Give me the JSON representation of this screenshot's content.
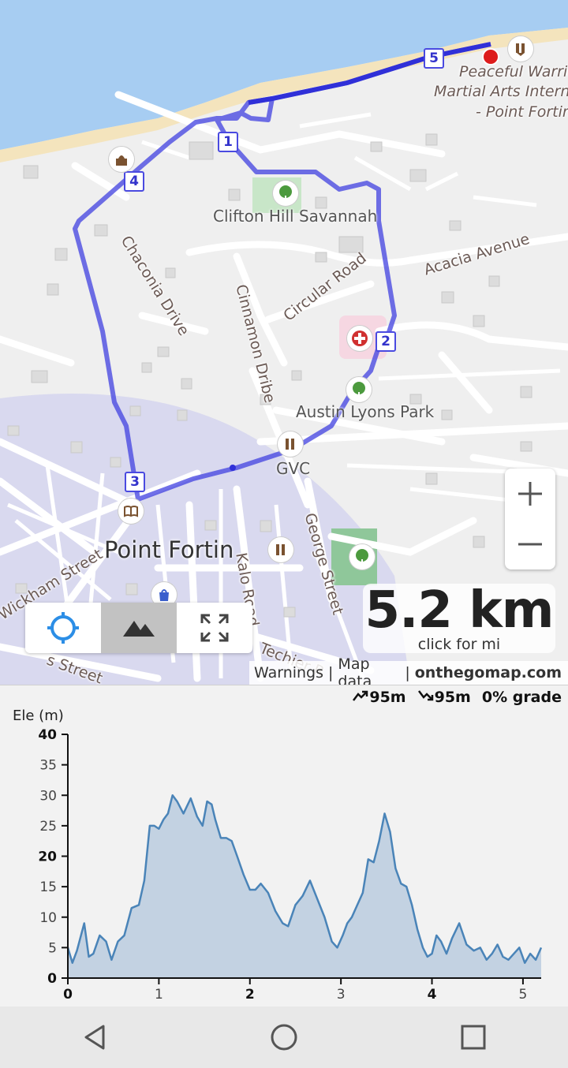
{
  "map": {
    "labels": {
      "clifton_hill": "Clifton Hill Savannah",
      "acacia": "Acacia Avenue",
      "chaconia": "Chaconia Drive",
      "cinnamon": "Cinnamon Dribe",
      "circular": "Circular Road",
      "austin": "Austin Lyons Park",
      "gvc": "GVC",
      "george": "George Street",
      "kalo": "Kalo Road",
      "techier": "Techier R",
      "wickham": "Wickham Street",
      "sts": "s Street",
      "point_fortin": "Point Fortin",
      "peaceful_1": "Peaceful Warrio",
      "peaceful_2": "Martial Arts Interna",
      "peaceful_3": "- Point Fortin"
    },
    "waypoints": [
      "1",
      "2",
      "3",
      "4",
      "5"
    ],
    "route_color": "#4040e0",
    "sea_color": "#a7cdf2"
  },
  "zoom": {
    "in": "+",
    "out": "−"
  },
  "distance": {
    "value": "5.2 km",
    "toggle": "click for mi"
  },
  "controls": {
    "locate_icon": "crosshair-icon",
    "terrain_icon": "mountain-icon",
    "fullscreen_icon": "expand-icon"
  },
  "attribution": {
    "warnings": "Warnings",
    "sep1": "|",
    "map_data": "Map data",
    "sep2": "|",
    "site": "onthegomap.com"
  },
  "elevation": {
    "ascent": "95m",
    "descent": "95m",
    "grade": "0% grade",
    "ylabel": "Ele (m)"
  },
  "chart_data": {
    "type": "area",
    "xlabel": "",
    "ylabel": "Ele (m)",
    "xlim": [
      0,
      5.2
    ],
    "ylim": [
      0,
      40
    ],
    "xticks": [
      "0",
      "1",
      "2",
      "3",
      "4",
      "5"
    ],
    "yticks": [
      "0",
      "5",
      "10",
      "15",
      "20",
      "25",
      "30",
      "35",
      "40"
    ],
    "x": [
      0,
      0.05,
      0.1,
      0.18,
      0.23,
      0.28,
      0.35,
      0.42,
      0.48,
      0.55,
      0.62,
      0.7,
      0.78,
      0.84,
      0.9,
      0.95,
      1.0,
      1.05,
      1.1,
      1.15,
      1.2,
      1.27,
      1.35,
      1.42,
      1.48,
      1.53,
      1.58,
      1.62,
      1.68,
      1.74,
      1.8,
      1.86,
      1.93,
      2.0,
      2.06,
      2.12,
      2.2,
      2.28,
      2.36,
      2.42,
      2.5,
      2.58,
      2.66,
      2.74,
      2.82,
      2.9,
      2.96,
      3.02,
      3.07,
      3.12,
      3.18,
      3.24,
      3.3,
      3.36,
      3.42,
      3.48,
      3.54,
      3.6,
      3.66,
      3.72,
      3.78,
      3.84,
      3.9,
      3.95,
      4.0,
      4.05,
      4.1,
      4.16,
      4.22,
      4.3,
      4.38,
      4.46,
      4.53,
      4.6,
      4.66,
      4.72,
      4.78,
      4.84,
      4.9,
      4.96,
      5.02,
      5.08,
      5.14,
      5.2
    ],
    "values": [
      5,
      2.5,
      4.5,
      9,
      3.5,
      4,
      7,
      6,
      3,
      6,
      7,
      11.5,
      12,
      16,
      25,
      25,
      24.5,
      26,
      27,
      30,
      29,
      27,
      29.5,
      26.5,
      25,
      29,
      28.5,
      26,
      23,
      23,
      22.5,
      20,
      17,
      14.5,
      14.5,
      15.5,
      14,
      11,
      9,
      8.5,
      12,
      13.5,
      16,
      13,
      10,
      6,
      5,
      7,
      9,
      10,
      12,
      14,
      19.5,
      19,
      22.5,
      27,
      24,
      18,
      15.5,
      15,
      12,
      8,
      5,
      3.5,
      4,
      7,
      6,
      4,
      6.5,
      9,
      5.5,
      4.5,
      5,
      3,
      4,
      5.5,
      3.5,
      3,
      4,
      5,
      2.5,
      4,
      3,
      5
    ]
  },
  "navbar": {
    "back_icon": "back-icon",
    "home_icon": "home-icon",
    "recents_icon": "recents-icon"
  }
}
